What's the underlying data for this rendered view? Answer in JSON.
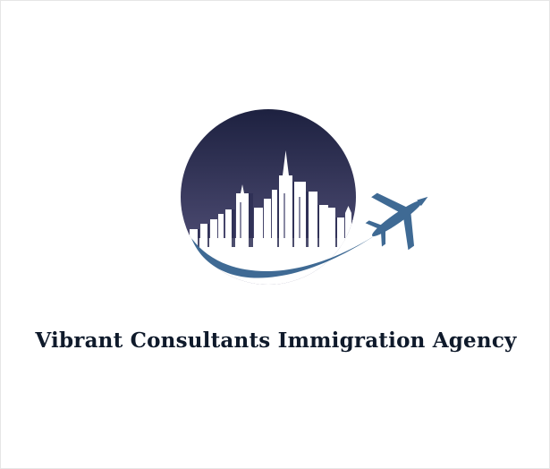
{
  "brand": {
    "name": "Vibrant Consultants Immigration Agency"
  },
  "logo": {
    "icon": "city-skyline-airplane-icon",
    "colors": {
      "sky_top": "#1d2140",
      "sky_bottom": "#58557f",
      "swoosh": "#3f6a94",
      "airplane": "#3f6a94",
      "buildings": "#ffffff",
      "text": "#0f1a2b"
    }
  }
}
